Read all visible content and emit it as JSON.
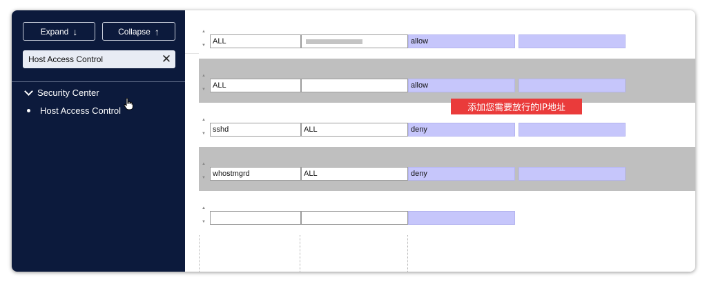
{
  "sidebar": {
    "expand_label": "Expand",
    "collapse_label": "Collapse",
    "search_value": "Host Access Control",
    "tree": {
      "group_label": "Security Center",
      "item_label": "Host Access Control"
    }
  },
  "rules": [
    {
      "daemon": "ALL",
      "client": "",
      "action": "allow"
    },
    {
      "daemon": "ALL",
      "client": "",
      "action": "allow"
    },
    {
      "daemon": "sshd",
      "client": "ALL",
      "action": "deny"
    },
    {
      "daemon": "whostmgrd",
      "client": "ALL",
      "action": "deny"
    },
    {
      "daemon": "",
      "client": "",
      "action": ""
    }
  ],
  "annotation": "添加您需要放行的IP地址",
  "colors": {
    "sidebar_bg": "#0c1a3c",
    "row_alt": "#bfbfbf",
    "action_cell": "#c6c6fb",
    "annotation_bg": "#ea3b3b"
  },
  "icons": {
    "expand": "arrow-down-icon",
    "collapse": "arrow-up-icon",
    "clear": "close-icon",
    "group": "chevron-down-icon",
    "item": "bullet-icon",
    "cursor": "hand-pointer-icon"
  }
}
